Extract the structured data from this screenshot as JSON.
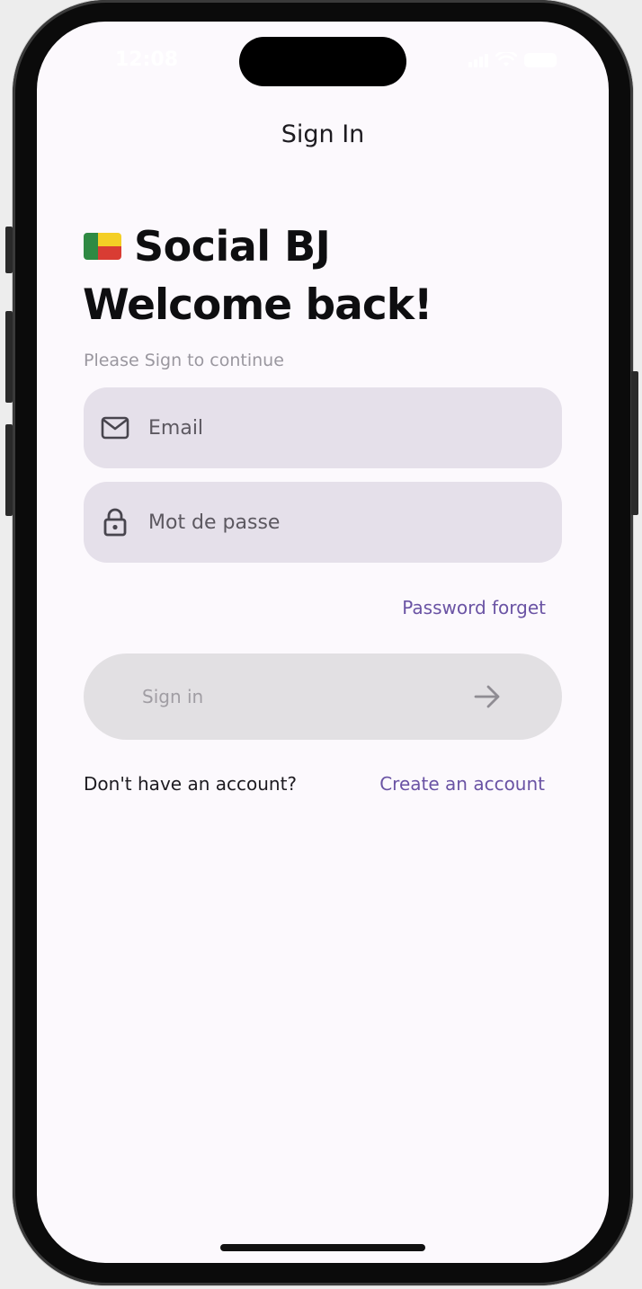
{
  "status_bar": {
    "time": "12:08"
  },
  "header": {
    "title": "Sign In"
  },
  "brand": {
    "name": "Social BJ",
    "flag_icon": "benin-flag-icon"
  },
  "intro": {
    "headline": "Welcome back!",
    "subtitle": "Please Sign to continue"
  },
  "form": {
    "email": {
      "placeholder": "Email",
      "icon": "mail-icon"
    },
    "password": {
      "placeholder": "Mot de passe",
      "icon": "lock-icon"
    },
    "forgot_label": "Password forget",
    "submit_label": "Sign in",
    "submit_icon": "arrow-right-icon"
  },
  "footer": {
    "prompt": "Don't have an account?",
    "create_label": "Create an account"
  },
  "colors": {
    "accent": "#6a53a4",
    "field_bg": "#e5e0ea",
    "button_disabled_bg": "#e2e0e3",
    "screen_bg": "#fcf9fd"
  }
}
